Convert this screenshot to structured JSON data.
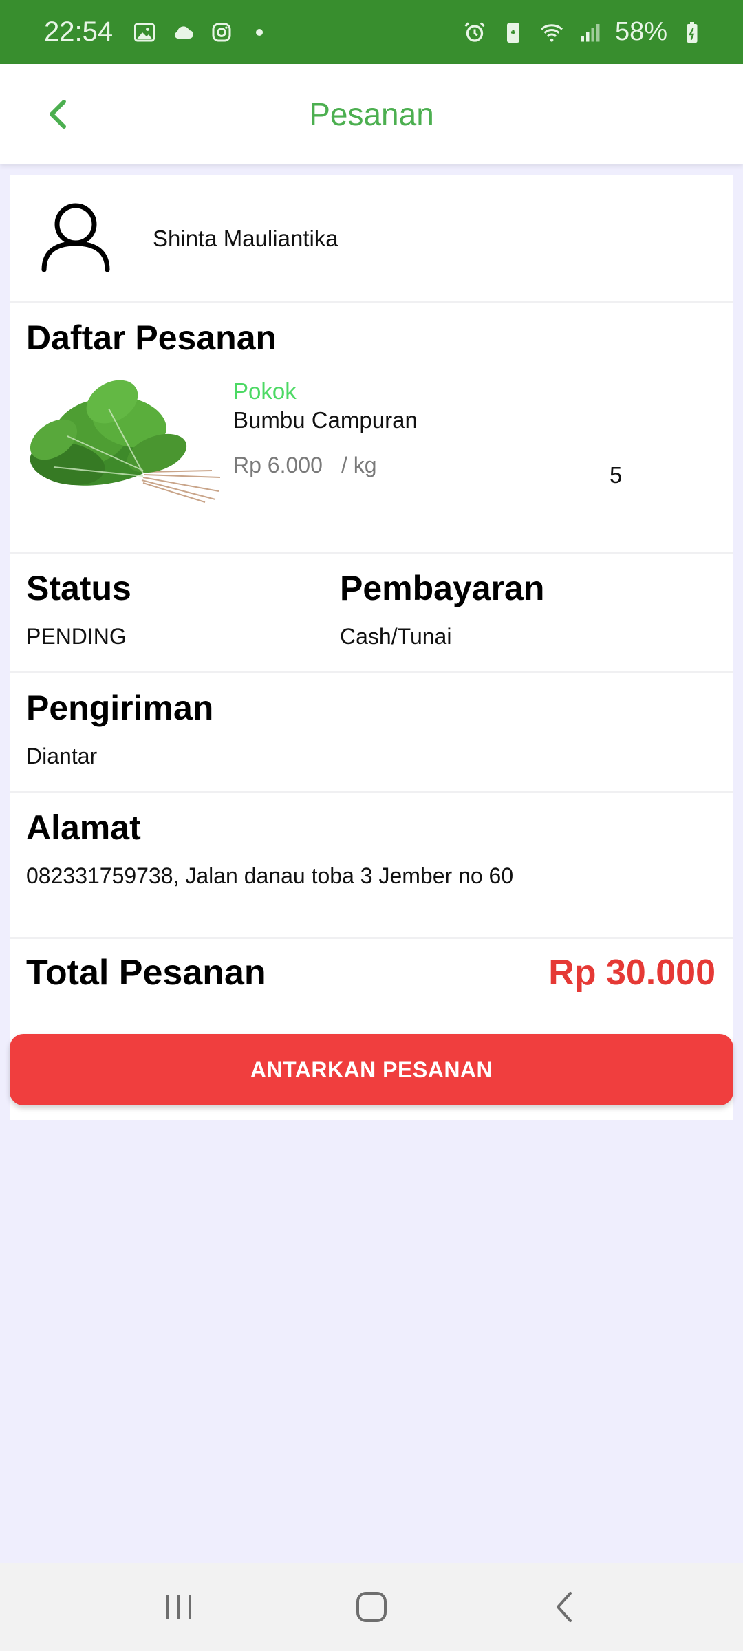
{
  "status_bar": {
    "time": "22:54",
    "battery": "58%",
    "left_icons": [
      "gallery-icon",
      "cloud-icon",
      "instagram-icon",
      "dot-icon"
    ],
    "right_icons": [
      "alarm-icon",
      "battery-saver-icon",
      "wifi-icon",
      "signal-icon",
      "battery-icon"
    ]
  },
  "app_bar": {
    "title": "Pesanan",
    "back_icon": "chevron-left-icon"
  },
  "customer": {
    "name": "Shinta Mauliantika",
    "avatar_icon": "user-icon"
  },
  "order_list": {
    "title": "Daftar Pesanan",
    "items": [
      {
        "category": "Pokok",
        "name": "Bumbu Campuran",
        "price": "Rp 6.000",
        "unit": "/ kg",
        "quantity": "5",
        "image": "spinach-image"
      }
    ]
  },
  "status": {
    "title": "Status",
    "value": "PENDING"
  },
  "payment": {
    "title": "Pembayaran",
    "value": "Cash/Tunai"
  },
  "shipping": {
    "title": "Pengiriman",
    "value": "Diantar"
  },
  "address": {
    "title": "Alamat",
    "value": "082331759738, Jalan danau toba 3 Jember no 60"
  },
  "total": {
    "label": "Total Pesanan",
    "value": "Rp 30.000"
  },
  "action": {
    "label": "ANTARKAN PESANAN"
  },
  "colors": {
    "status_bar": "#388E2E",
    "accent_green": "#4CAF50",
    "category_green": "#4CD964",
    "total_red": "#E53935",
    "button_red": "#F03E3E",
    "background": "#EFEEFD"
  },
  "nav_bar": {
    "icons": [
      "recent-apps-icon",
      "home-icon",
      "back-icon"
    ]
  }
}
